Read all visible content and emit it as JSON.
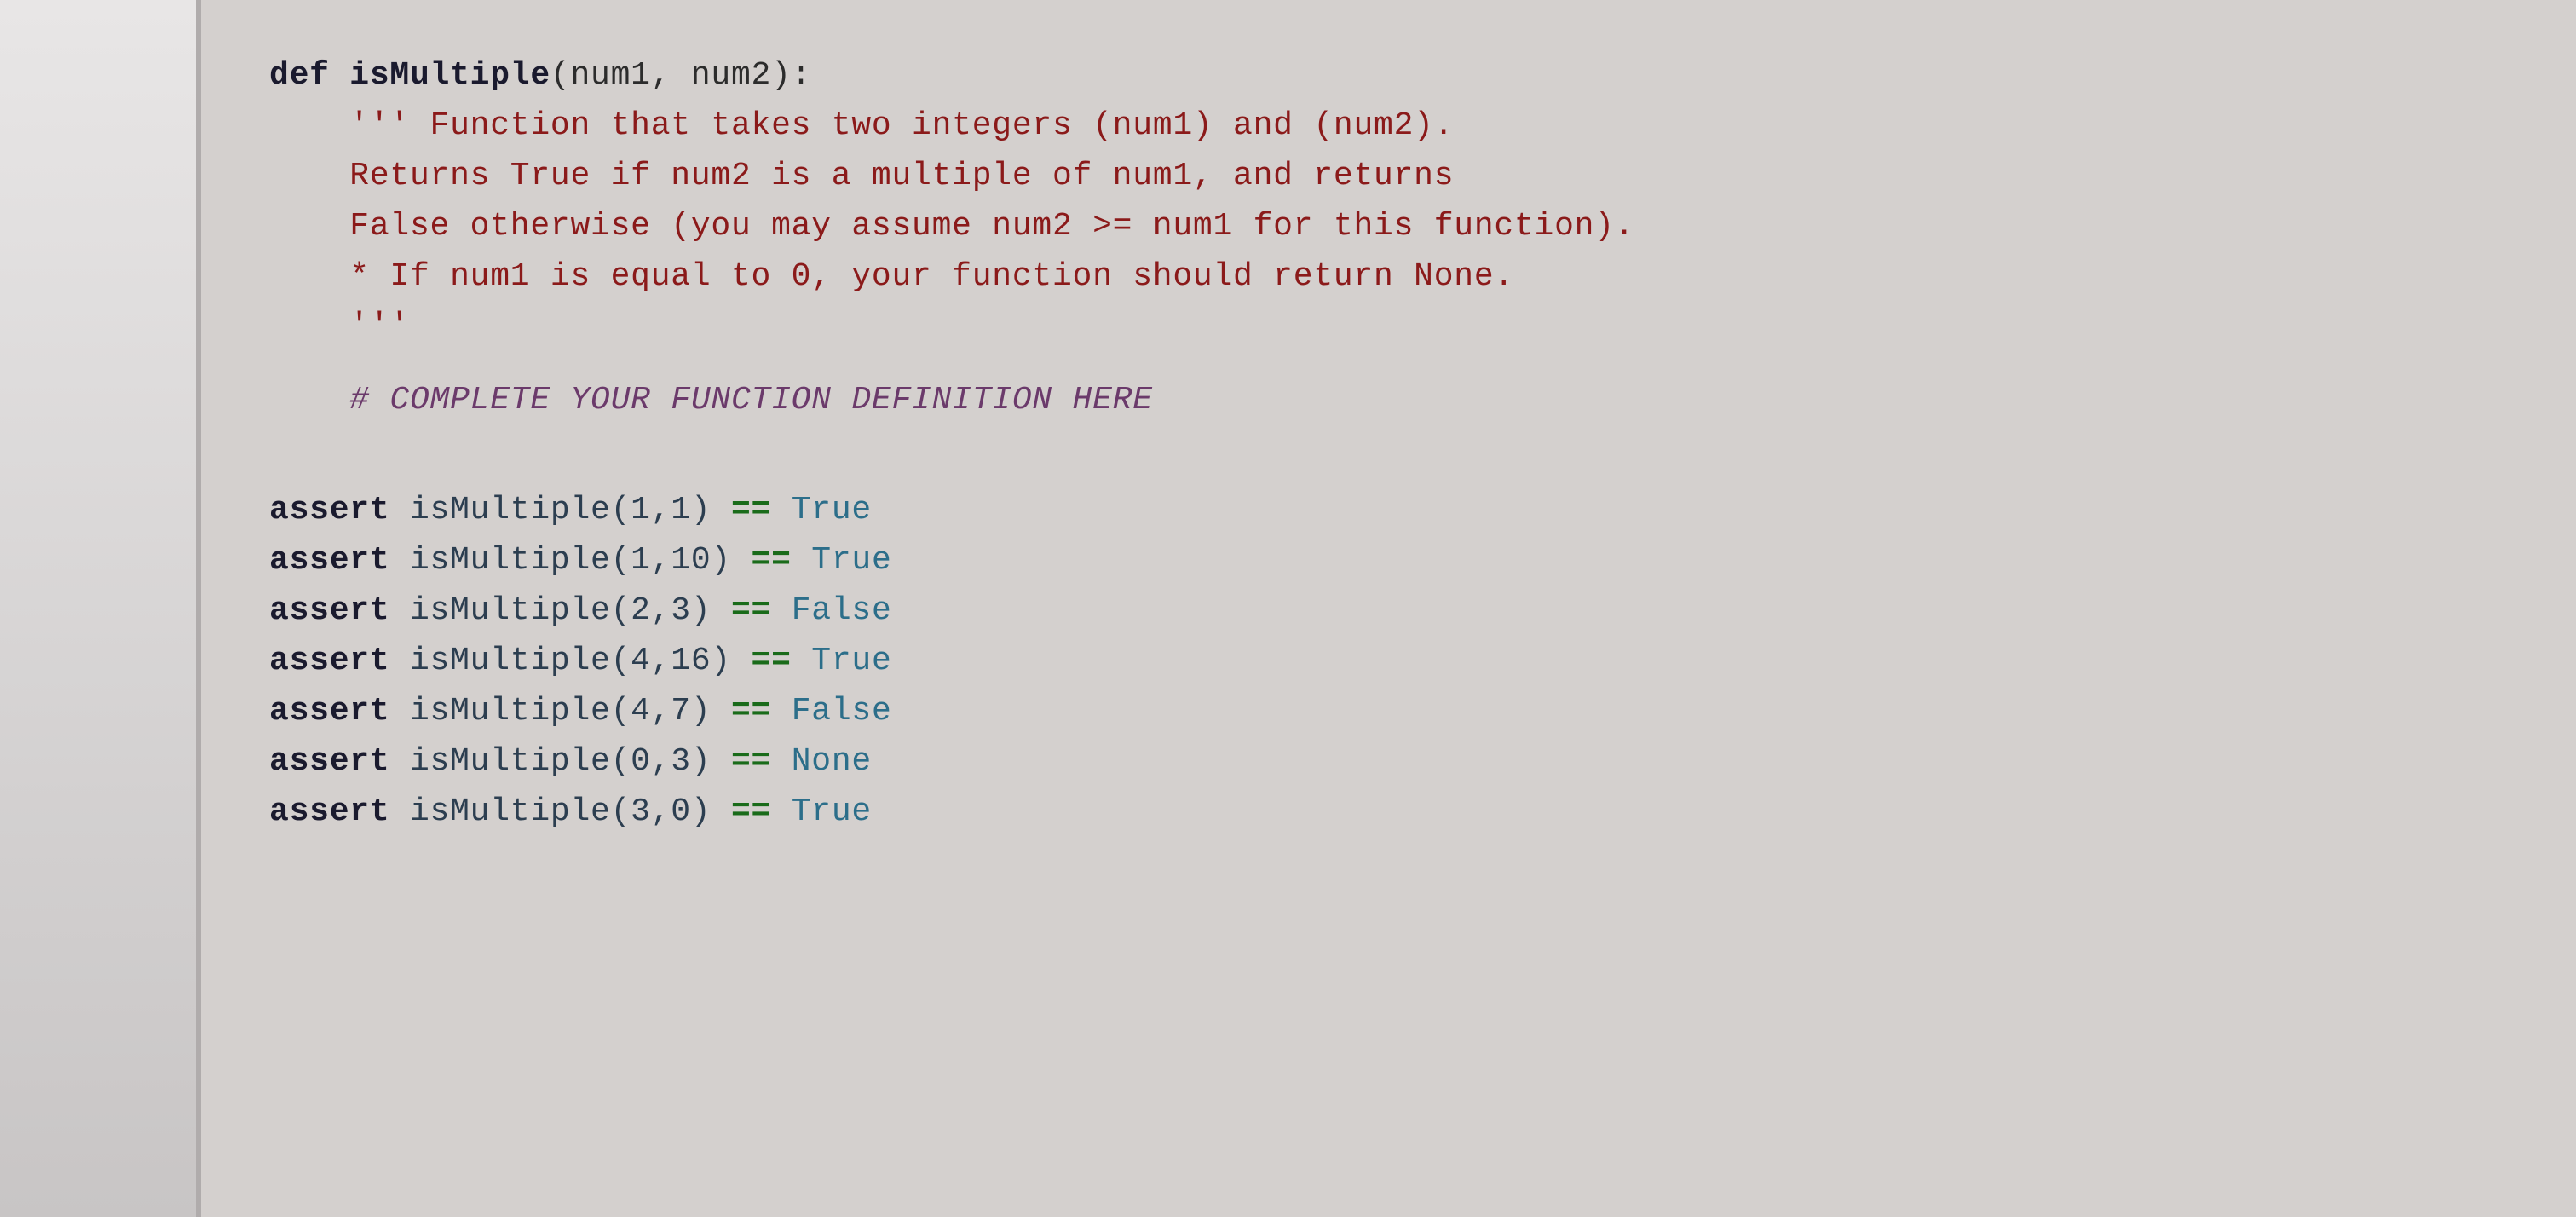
{
  "code": {
    "def_line": {
      "keyword": "def ",
      "funcname": "isMultiple",
      "params": "(num1, num2):"
    },
    "docstring_lines": [
      "    ''' Function that takes two integers (num1) and (num2).",
      "    Returns True if num2 is a multiple of num1, and returns",
      "    False otherwise (you may assume num2 >= num1 for this function).",
      "    * If num1 is equal to 0, your function should return None.",
      "    '''"
    ],
    "comment_line": "    # COMPLETE YOUR FUNCTION DEFINITION HERE",
    "assert_lines": [
      {
        "call": "isMultiple(1,1)",
        "op": "==",
        "value": "True"
      },
      {
        "call": "isMultiple(1,10)",
        "op": "==",
        "value": "True"
      },
      {
        "call": "isMultiple(2,3)",
        "op": "==",
        "value": "False"
      },
      {
        "call": "isMultiple(4,16)",
        "op": "==",
        "value": "True"
      },
      {
        "call": "isMultiple(4,7)",
        "op": "==",
        "value": "False"
      },
      {
        "call": "isMultiple(0,3)",
        "op": "==",
        "value": "None"
      },
      {
        "call": "isMultiple(3,0)",
        "op": "==",
        "value": "True"
      }
    ],
    "assert_keyword": "assert ",
    "spacing_between_eq": " == "
  }
}
